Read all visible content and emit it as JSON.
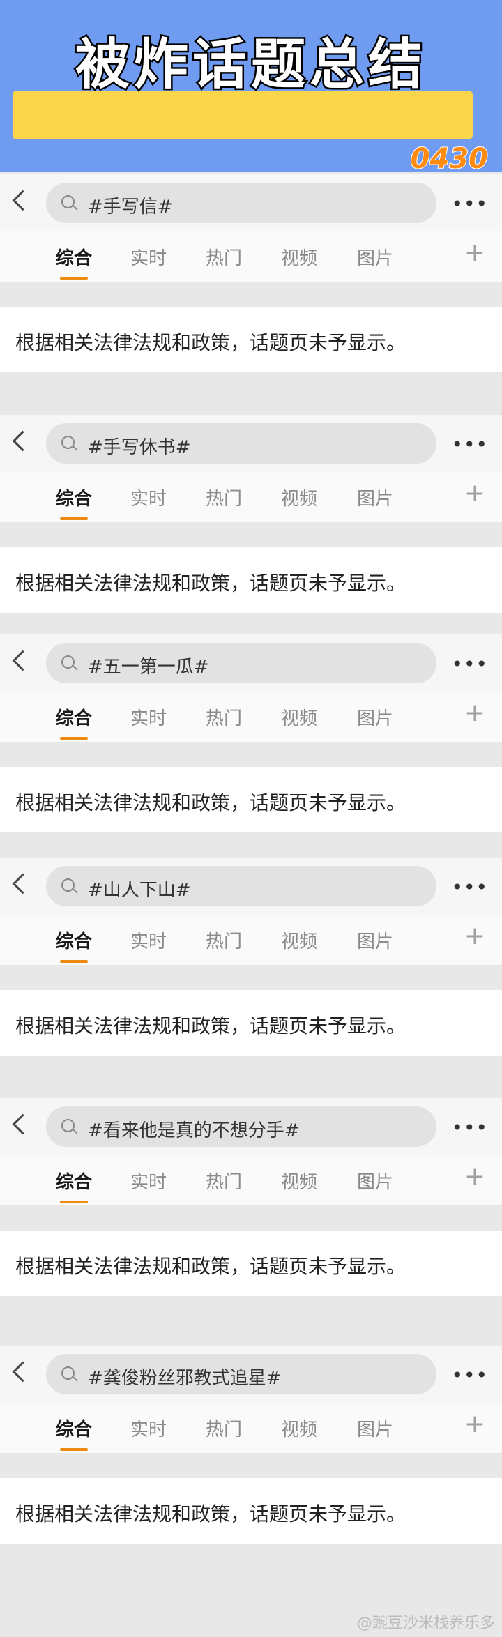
{
  "header": {
    "title": "被炸话题总结",
    "date": "0430"
  },
  "tabs": [
    "综合",
    "实时",
    "热门",
    "视频",
    "图片"
  ],
  "notice": "根据相关法律法规和政策，话题页未予显示。",
  "cards": [
    {
      "search_text": "#手写信#"
    },
    {
      "search_text": "#手写休书#"
    },
    {
      "search_text": "#五一第一瓜#"
    },
    {
      "search_text": "#山人下山#"
    },
    {
      "search_text": "#看来他是真的不想分手#"
    },
    {
      "search_text": "#龚俊粉丝邪教式追星#"
    }
  ],
  "more_label": "•••",
  "plus_label": "+",
  "watermark": "@豌豆沙米栈养乐多"
}
